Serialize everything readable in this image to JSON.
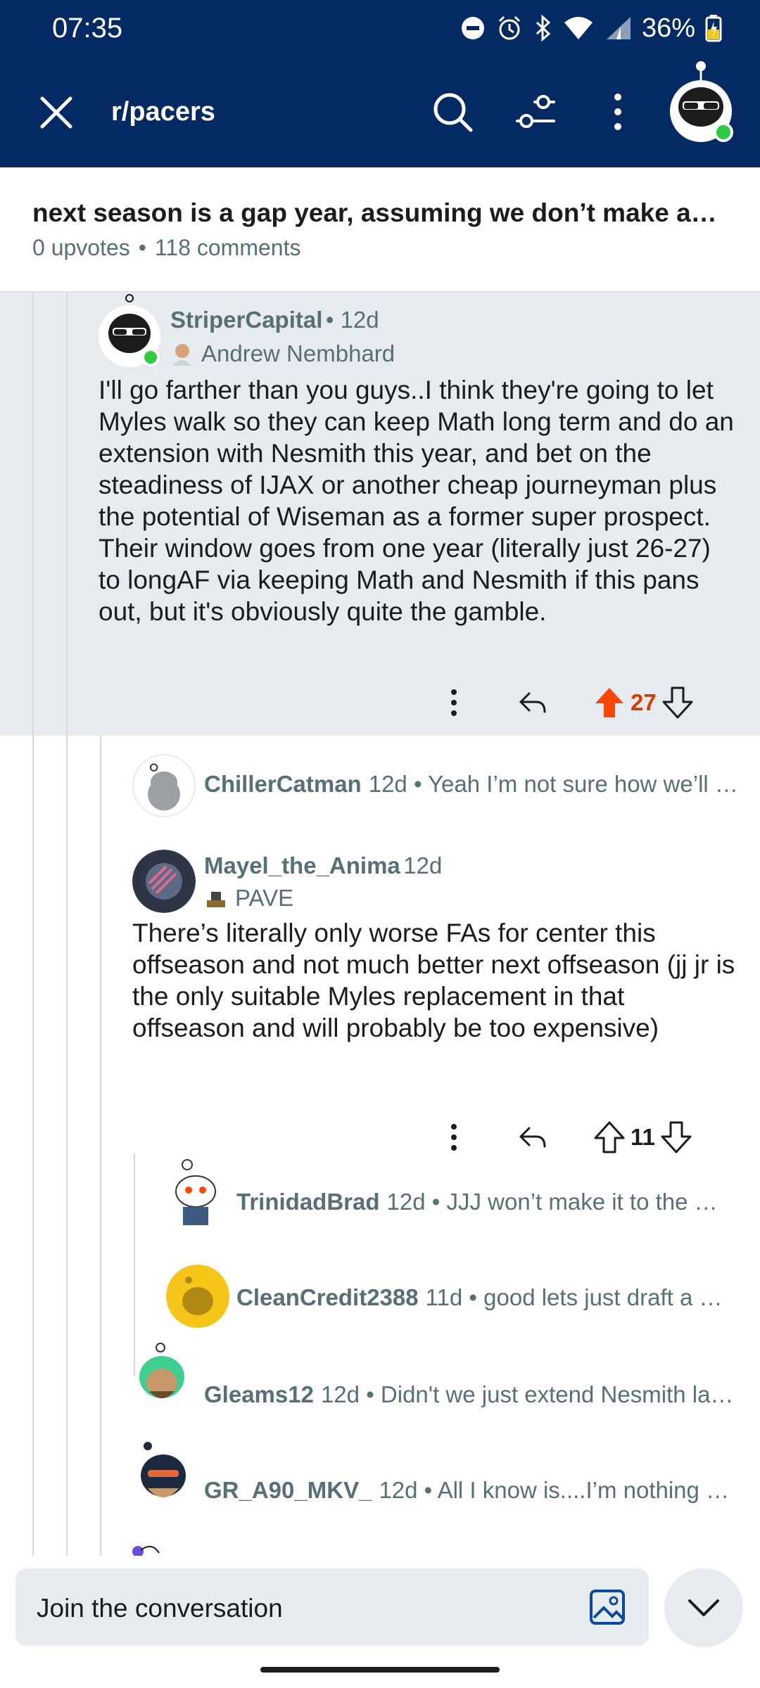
{
  "status_bar": {
    "time": "07:35",
    "battery": "36%"
  },
  "header": {
    "subreddit": "r/pacers"
  },
  "post": {
    "title": "next season is a gap year, assuming we don’t make an…",
    "upvotes": "0 upvotes",
    "comments": "118 comments"
  },
  "highlighted_comment": {
    "username": "StriperCapital",
    "age": "• 12d",
    "flair": "Andrew Nembhard",
    "body": "I'll go farther than you guys..I think they're going to let Myles walk so they can keep Math long term and do an extension with Nesmith this year, and bet on the steadiness of IJAX or another cheap journeyman plus the potential of Wiseman as a former super prospect. Their window goes from one year (literally just 26-27) to longAF via keeping Math and Nesmith if this pans out, but it's obviously quite the gamble.",
    "votes": "27"
  },
  "reply_collapsed_1": {
    "username": "ChillerCatman",
    "age": "12d",
    "preview": "• Yeah I’m not sure how we’ll …"
  },
  "reply_expanded": {
    "username": "Mayel_the_Anima",
    "age": "12d",
    "flair": "PAVE",
    "body": "There’s literally only worse FAs for center this offseason and not much better next offseason (jj jr is the only suitable Myles replacement in that offseason and will probably be too expensive)",
    "votes": "11"
  },
  "nested_replies": [
    {
      "username": "TrinidadBrad",
      "age": "12d",
      "preview": "• JJJ won’t make it to the m…"
    },
    {
      "username": "CleanCredit2388",
      "age": "11d",
      "preview": "• good lets just draft a r…"
    }
  ],
  "more_replies": [
    {
      "username": "Gleams12",
      "age": "12d",
      "preview": "• Didn't we just extend Nesmith la…"
    },
    {
      "username": "GR_A90_MKV_",
      "age": "12d",
      "preview": "• All I know is....I’m nothing o…"
    }
  ],
  "composer": {
    "placeholder": "Join the conversation"
  },
  "colors": {
    "header_bg": "#032a63",
    "upvote_active": "#ff4500",
    "highlight_bg": "#e5ebee",
    "meta_gray": "#576f76"
  }
}
